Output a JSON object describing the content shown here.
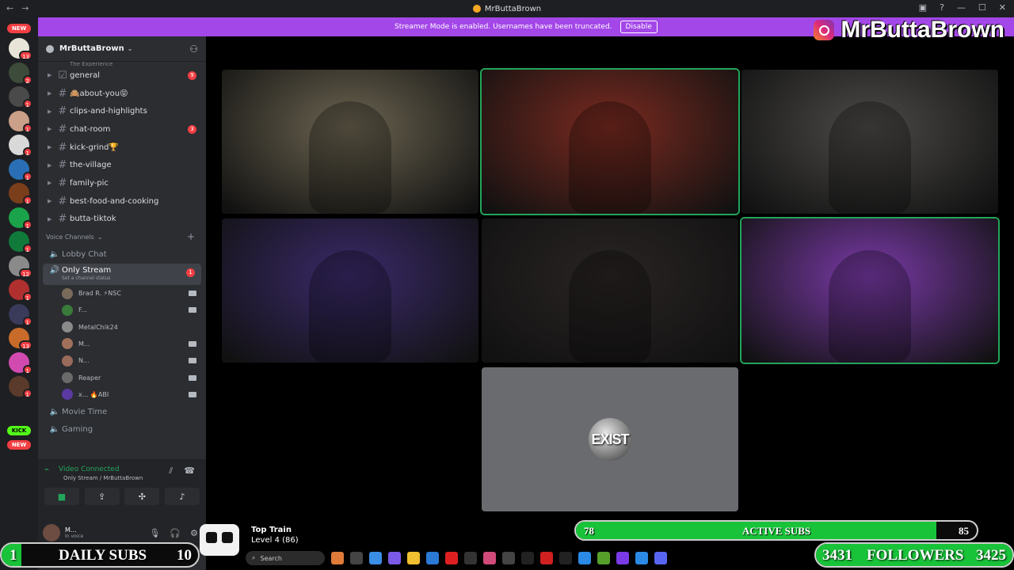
{
  "window": {
    "title": "MrButtaBrown"
  },
  "banner": {
    "message": "Streamer Mode is enabled. Usernames have been truncated.",
    "disable_label": "Disable"
  },
  "brand": {
    "name": "MrButtaBrown"
  },
  "rail": {
    "new_label": "NEW",
    "servers": [
      {
        "badge": "13",
        "color": "#e8e4d8"
      },
      {
        "badge": "2",
        "color": "#3c4b3a"
      },
      {
        "badge": "1",
        "color": "#4a4a4a"
      },
      {
        "badge": "1",
        "color": "#caa088"
      },
      {
        "badge": "1",
        "color": "#d9d9d9"
      },
      {
        "badge": "1",
        "color": "#2a6fb5"
      },
      {
        "badge": "1",
        "color": "#7a3f1a"
      },
      {
        "badge": "1",
        "color": "#1aa34a"
      },
      {
        "badge": "1",
        "color": "#0f7a3a"
      },
      {
        "badge": "12",
        "color": "#8a8a8a"
      },
      {
        "badge": "1",
        "color": "#b03030"
      },
      {
        "badge": "1",
        "color": "#3a3a5a"
      },
      {
        "badge": "13",
        "color": "#c86b2a"
      },
      {
        "badge": "1",
        "color": "#d04ab0"
      },
      {
        "badge": "1",
        "color": "#5a3a2a"
      }
    ],
    "kick_label": "KICK",
    "new_label_bottom": "NEW"
  },
  "sidebar": {
    "server_name": "MrButtaBrown",
    "category_cut": "The Experience",
    "channels": [
      {
        "name": "general",
        "badge": "9",
        "rules": true
      },
      {
        "name": "🙈about-you😝",
        "badge": ""
      },
      {
        "name": "clips-and-highlights",
        "badge": ""
      },
      {
        "name": "chat-room",
        "badge": "3"
      },
      {
        "name": "kick-grind🏆",
        "badge": ""
      },
      {
        "name": "the-village",
        "badge": ""
      },
      {
        "name": "family-pic",
        "badge": ""
      },
      {
        "name": "best-food-and-cooking",
        "badge": ""
      },
      {
        "name": "butta-tiktok",
        "badge": ""
      }
    ],
    "voice_category": "Voice Channels",
    "voice_channels_top": [
      {
        "name": "Lobby Chat"
      }
    ],
    "active_voice": {
      "name": "Only Stream",
      "status": "Set a channel status",
      "badge": "1"
    },
    "voice_users": [
      {
        "name": "Brad R. ⚡NSC",
        "color": "#7a6a5a",
        "cam": true
      },
      {
        "name": "F...",
        "color": "#3a7a3a",
        "cam": true
      },
      {
        "name": "MetalChik24",
        "color": "#8a8a8a",
        "cam": false
      },
      {
        "name": "M...",
        "color": "#a0705a",
        "cam": true
      },
      {
        "name": "N...",
        "color": "#9a6a5a",
        "cam": true
      },
      {
        "name": "Reaper",
        "color": "#6a6a6a",
        "cam": true
      },
      {
        "name": "x... 🔥ABI",
        "color": "#5a3aa0",
        "cam": true
      }
    ],
    "voice_channels_bottom": [
      {
        "name": "Movie Time"
      },
      {
        "name": "Gaming"
      }
    ]
  },
  "voice_panel": {
    "title": "Video Connected",
    "subtitle": "Only Stream / MrButtaBrown",
    "me_name": "M...",
    "me_status": "In voice"
  },
  "video_tiles": [
    {
      "name": "tile-bearded-man",
      "bg": "#6b6450",
      "speaking": false
    },
    {
      "name": "tile-horror-streamer",
      "bg": "#7a2a20",
      "speaking": true
    },
    {
      "name": "tile-headset-gamer",
      "bg": "#4c4a48",
      "speaking": false
    },
    {
      "name": "tile-purple-light-woman",
      "bg": "#3a2a6a",
      "speaking": false
    },
    {
      "name": "tile-young-man",
      "bg": "#2a2424",
      "speaking": false
    },
    {
      "name": "tile-mushroom-scene",
      "bg": "#7a3aa8",
      "speaking": true
    }
  ],
  "exist_tile": {
    "label": "EXIST"
  },
  "train": {
    "title": "Top Train",
    "level": "Level 4  (86)"
  },
  "subs_bar": {
    "start": "78",
    "label": "ACTIVE SUBS",
    "goal": "85",
    "progress": 0.9
  },
  "daily_subs": {
    "current": "1",
    "label": "DAILY SUBS",
    "goal": "10",
    "progress": 0.1
  },
  "followers": {
    "current": "3431",
    "label": "FOLLOWERS",
    "goal": "3425",
    "progress": 1.0
  },
  "taskbar": {
    "search_label": "Search"
  }
}
